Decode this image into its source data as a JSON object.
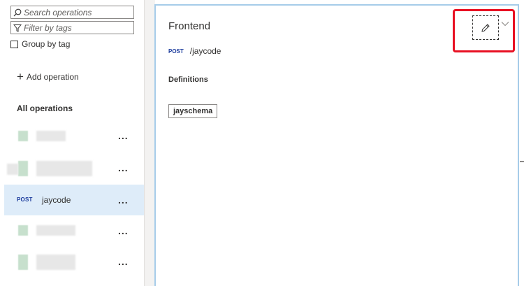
{
  "sidebar": {
    "search_placeholder": "Search operations",
    "filter_placeholder": "Filter by tags",
    "group_by_tag_label": "Group by tag",
    "add_operation_label": "Add operation",
    "all_operations_label": "All operations",
    "operations": [
      {
        "method": "",
        "name": "",
        "more": "..."
      },
      {
        "method": "",
        "name": "",
        "more": "..."
      },
      {
        "method": "POST",
        "name": "jaycode",
        "more": "...",
        "selected": true
      },
      {
        "method": "",
        "name": "",
        "more": "..."
      },
      {
        "method": "",
        "name": "",
        "more": "..."
      }
    ]
  },
  "frontend": {
    "title": "Frontend",
    "method": "POST",
    "path": "/jaycode",
    "definitions_label": "Definitions",
    "definitions": [
      "jayschema"
    ]
  },
  "colors": {
    "accent": "#a6cce9",
    "selected_row": "#deecf9",
    "method_text": "#1a3a9c",
    "highlight": "#e81123"
  }
}
